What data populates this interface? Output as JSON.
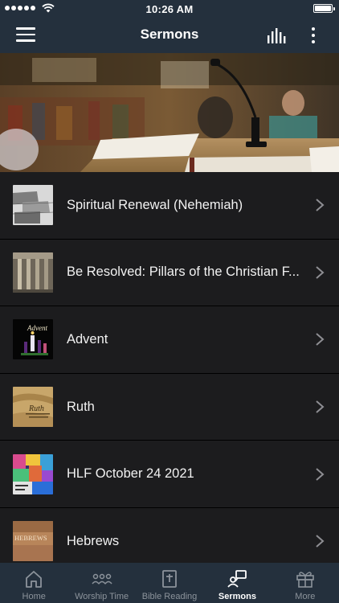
{
  "status_bar": {
    "time": "10:26 AM"
  },
  "header": {
    "title": "Sermons"
  },
  "sermons": [
    {
      "title": "Spiritual Renewal (Nehemiah)",
      "thumb_text": ""
    },
    {
      "title": "Be Resolved: Pillars of the Christian F...",
      "thumb_text": ""
    },
    {
      "title": "Advent",
      "thumb_text": "Advent"
    },
    {
      "title": "Ruth",
      "thumb_text": "Ruth"
    },
    {
      "title": "HLF October 24 2021",
      "thumb_text": ""
    },
    {
      "title": "Hebrews",
      "thumb_text": "HEBREWS"
    }
  ],
  "tabs": [
    {
      "label": "Home",
      "icon": "home-icon"
    },
    {
      "label": "Worship Time",
      "icon": "people-icon"
    },
    {
      "label": "Bible Reading",
      "icon": "bible-icon"
    },
    {
      "label": "Sermons",
      "icon": "sermons-icon"
    },
    {
      "label": "More",
      "icon": "gift-icon"
    }
  ],
  "colors": {
    "nav_bg": "#24303d",
    "list_bg": "#1c1c1e",
    "tab_inactive": "#8c939b",
    "tab_active": "#ffffff"
  }
}
